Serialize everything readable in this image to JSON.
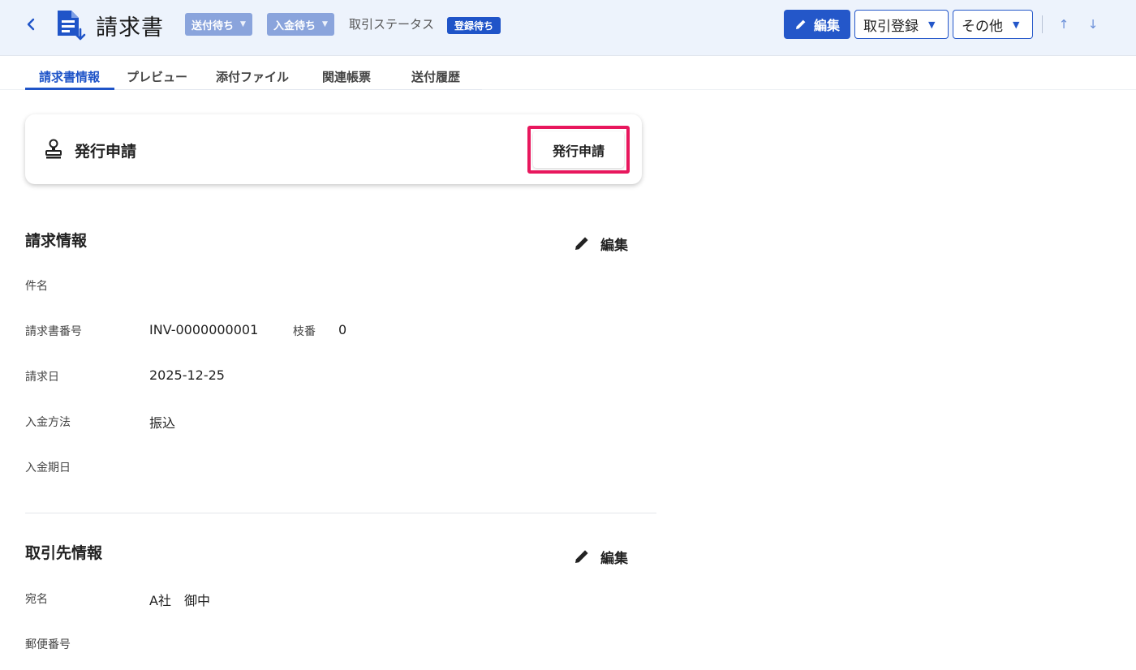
{
  "header": {
    "title": "請求書",
    "chips": [
      "送付待ち",
      "入金待ち"
    ],
    "status_label": "取引ステータス",
    "status_badge": "登録待ち",
    "edit_button": "編集",
    "register_button": "取引登録",
    "other_button": "その他"
  },
  "tabs": [
    "請求書情報",
    "プレビュー",
    "添付ファイル",
    "関連帳票",
    "送付履歴"
  ],
  "issue_card": {
    "title": "発行申請",
    "button": "発行申請"
  },
  "invoice_section": {
    "title": "請求情報",
    "edit_label": "編集",
    "fields": {
      "subject_label": "件名",
      "number_label": "請求書番号",
      "number_value": "INV-0000000001",
      "branch_label": "枝番",
      "branch_value": "0",
      "date_label": "請求日",
      "date_value": "2025-12-25",
      "payment_method_label": "入金方法",
      "payment_method_value": "振込",
      "due_date_label": "入金期日"
    }
  },
  "partner_section": {
    "title": "取引先情報",
    "edit_label": "編集",
    "fields": {
      "name_label": "宛名",
      "name_value": "A社　御中",
      "postal_label": "郵便番号"
    }
  },
  "colors": {
    "accent": "#1f54c8",
    "chip": "#8aa4dc",
    "highlight": "#e8175d",
    "header_bg": "#edf3fc"
  }
}
